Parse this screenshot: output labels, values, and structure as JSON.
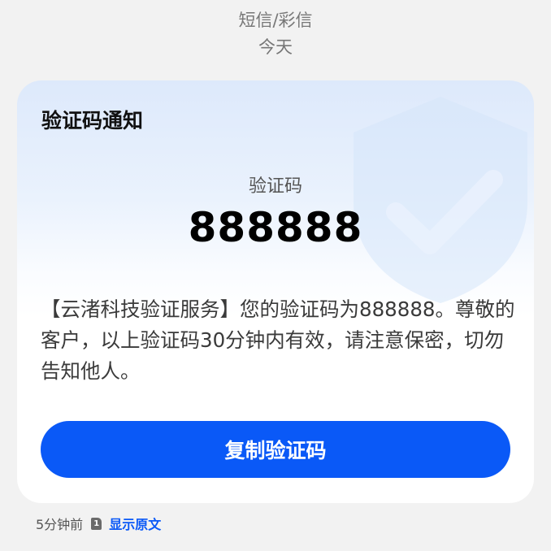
{
  "header": {
    "source": "短信/彩信",
    "date": "今天"
  },
  "card": {
    "title": "验证码通知",
    "code_label": "验证码",
    "code": "888888",
    "message": "【云渚科技验证服务】您的验证码为888888。尊敬的客户，以上验证码30分钟内有效，请注意保密，切勿告知他人。",
    "copy_button": "复制验证码",
    "decoration_icon": "shield-check-icon"
  },
  "footer": {
    "time": "5分钟前",
    "sim_label": "1",
    "show_original": "显示原文"
  },
  "colors": {
    "accent": "#0a59f7",
    "background": "#f2f2f2",
    "card_gradient_top": "#dde9fb"
  }
}
